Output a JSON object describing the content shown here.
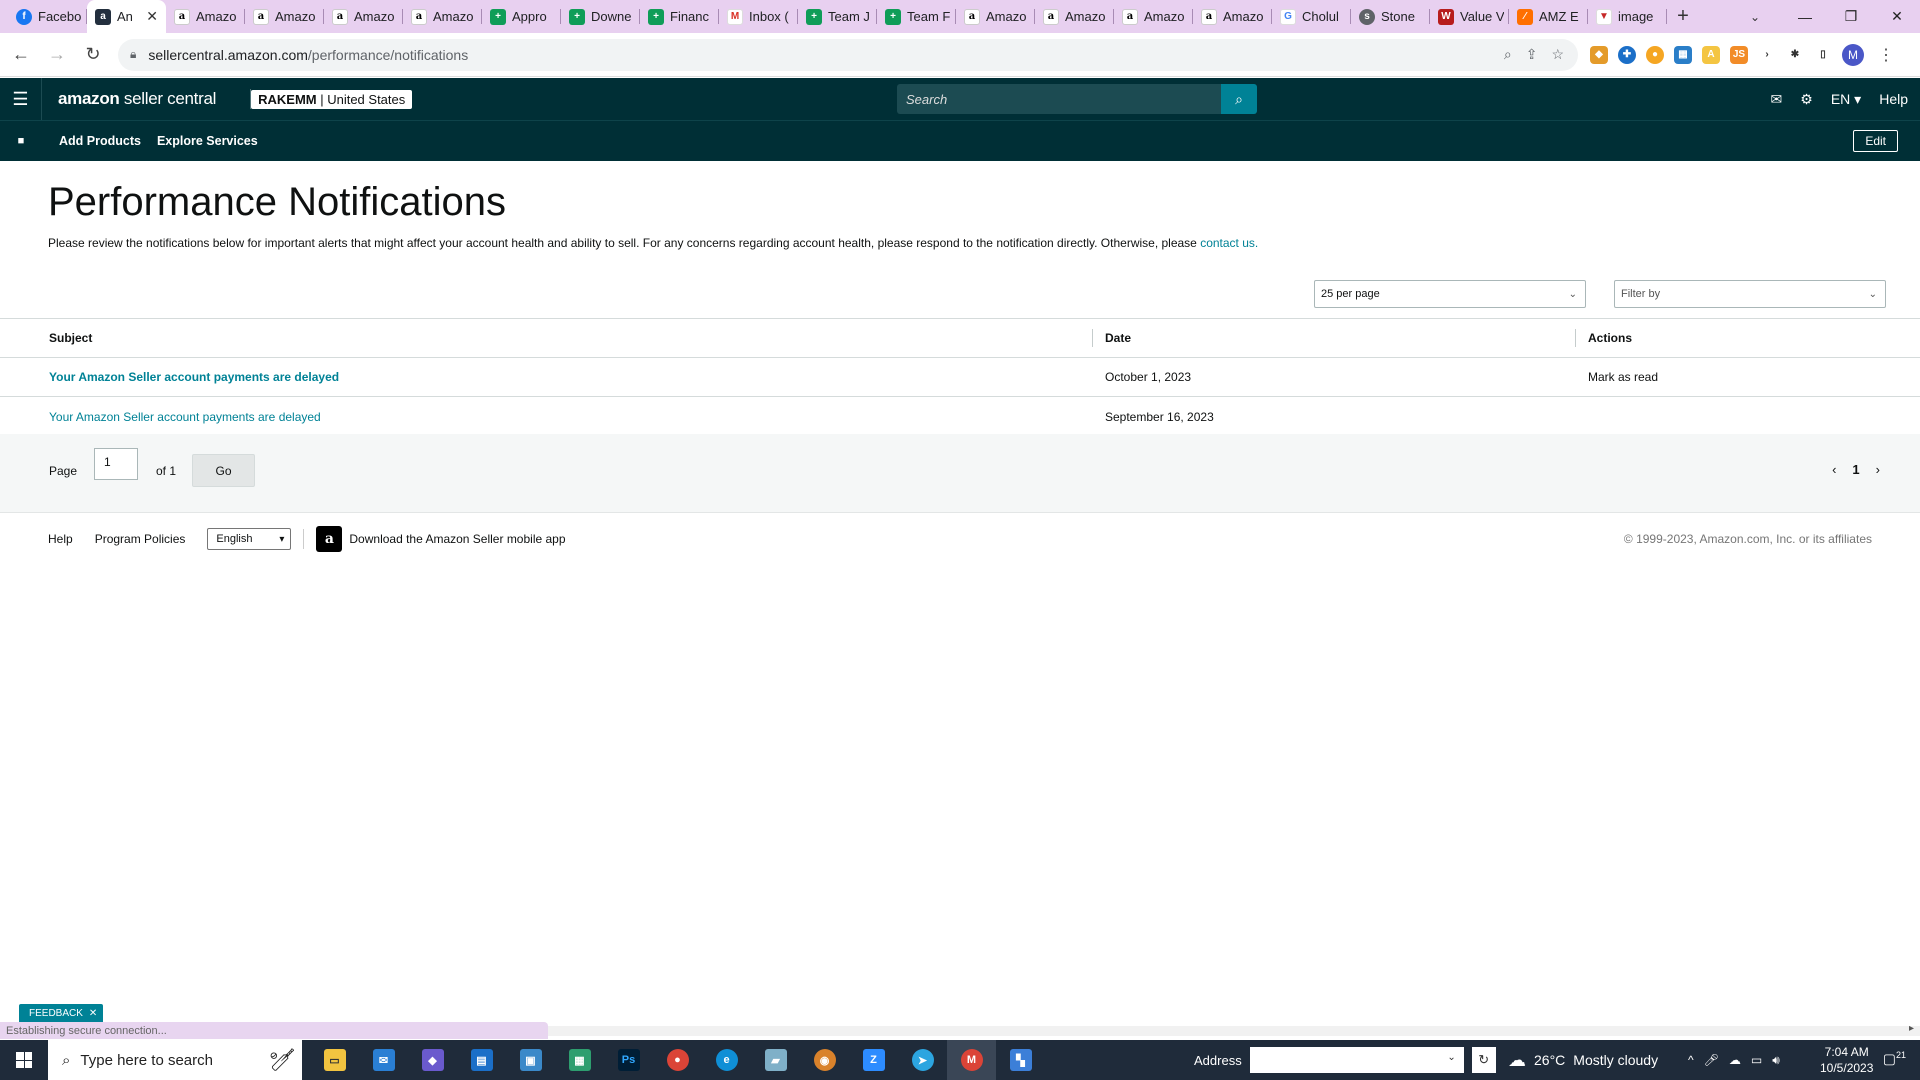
{
  "browser": {
    "tabs": [
      {
        "label": "Facebo",
        "icon": "facebook-icon",
        "color": "#1877f2"
      },
      {
        "label": "An",
        "icon": "amazon-icon",
        "active": true
      },
      {
        "label": "Amazo",
        "icon": "amazon-icon"
      },
      {
        "label": "Amazo",
        "icon": "amazon-icon"
      },
      {
        "label": "Amazo",
        "icon": "amazon-icon"
      },
      {
        "label": "Amazo",
        "icon": "amazon-icon"
      },
      {
        "label": "Appro",
        "icon": "sheets-icon"
      },
      {
        "label": "Downe",
        "icon": "sheets-icon"
      },
      {
        "label": "Financ",
        "icon": "sheets-icon"
      },
      {
        "label": "Inbox (",
        "icon": "gmail-icon"
      },
      {
        "label": "Team J",
        "icon": "sheets-icon"
      },
      {
        "label": "Team F",
        "icon": "sheets-icon"
      },
      {
        "label": "Amazo",
        "icon": "amazon-icon"
      },
      {
        "label": "Amazo",
        "icon": "amazon-icon"
      },
      {
        "label": "Amazo",
        "icon": "amazon-icon"
      },
      {
        "label": "Amazo",
        "icon": "amazon-icon"
      },
      {
        "label": "Cholul",
        "icon": "google-icon"
      },
      {
        "label": "Stone",
        "icon": "stone-icon"
      },
      {
        "label": "Value V",
        "icon": "value-icon"
      },
      {
        "label": "AMZ E",
        "icon": "amz-e-icon"
      },
      {
        "label": "image",
        "icon": "image-icon"
      }
    ],
    "url_host": "sellercentral.amazon.com",
    "url_path": "/performance/notifications",
    "profile_initial": "M"
  },
  "header": {
    "logo_bold": "amazon",
    "logo_rest": " seller central",
    "store_name": "RAKEMM",
    "store_region": " | United States",
    "search_placeholder": "Search",
    "lang": "EN",
    "help": "Help"
  },
  "subnav": {
    "links": [
      "Add Products",
      "Explore Services"
    ],
    "edit": "Edit"
  },
  "main": {
    "title": "Performance Notifications",
    "description": "Please review the notifications below for important alerts that might affect your account health and ability to sell. For any concerns regarding account health, please respond to the notification directly. Otherwise, please ",
    "contact_link": "contact us.",
    "per_page": "25 per page",
    "filter_placeholder": "Filter by",
    "columns": [
      "Subject",
      "Date",
      "Actions"
    ],
    "rows": [
      {
        "subject": "Your Amazon Seller account payments are delayed",
        "date": "October 1, 2023",
        "action": "Mark as read",
        "unread": true
      },
      {
        "subject": "Your Amazon Seller account payments are delayed",
        "date": "September 16, 2023",
        "action": "",
        "unread": false
      }
    ],
    "pagination": {
      "page_label": "Page",
      "page_value": "1",
      "of_label": "of 1",
      "go": "Go",
      "current": "1"
    }
  },
  "footer": {
    "help": "Help",
    "program_policies": "Program Policies",
    "language": "English",
    "app_text": "Download the Amazon Seller mobile app",
    "copyright": "© 1999-2023, Amazon.com, Inc. or its affiliates"
  },
  "feedback": {
    "label": "FEEDBACK"
  },
  "status_text": "Establishing secure connection...",
  "taskbar": {
    "search_placeholder": "Type here to search",
    "address_label": "Address",
    "temperature": "26°C",
    "weather": "Mostly cloudy",
    "time": "7:04 AM",
    "date": "10/5/2023",
    "notification_count": "21"
  },
  "colors": {
    "header_bg": "#002f36",
    "link": "#008296",
    "tabstrip": "#e8d0f0"
  }
}
